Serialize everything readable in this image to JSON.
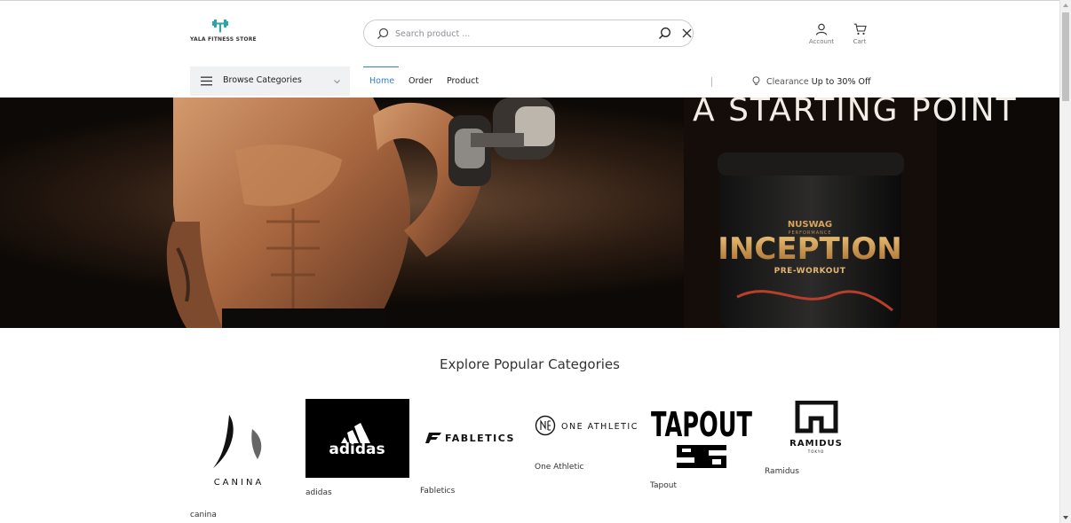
{
  "header": {
    "logo_text": "YALA FITNESS STORE",
    "search_placeholder": "Search product ...",
    "account_label": "Account",
    "cart_label": "Cart"
  },
  "nav": {
    "browse_label": "Browse Categories",
    "items": [
      {
        "label": "Home",
        "active": true
      },
      {
        "label": "Order"
      },
      {
        "label": "Product"
      }
    ],
    "clearance_prefix": "Clearance",
    "clearance_highlight": "Up to 30% Off"
  },
  "hero": {
    "headline": "A STARTING POINT",
    "product_brand": "NUSWAG",
    "product_brand_sub": "PERFORMANCE",
    "product_name": "INCEPTION",
    "product_type": "PRE-WORKOUT"
  },
  "categories": {
    "title": "Explore Popular Categories",
    "brands": [
      {
        "name": "canina",
        "logo_text": "CANINA"
      },
      {
        "name": "adidas",
        "logo_text": "adidas"
      },
      {
        "name": "Fabletics",
        "logo_text": "FABLETICS"
      },
      {
        "name": "One Athletic",
        "logo_text": "ONE ATHLETIC"
      },
      {
        "name": "Tapout",
        "logo_text": "TAPOUT"
      },
      {
        "name": "Ramidus",
        "logo_text": "RAMIDUS",
        "logo_sub": "TOKYO"
      }
    ]
  },
  "colors": {
    "accent": "#2f7fd8",
    "logo_teal": "#2aa7a4"
  }
}
